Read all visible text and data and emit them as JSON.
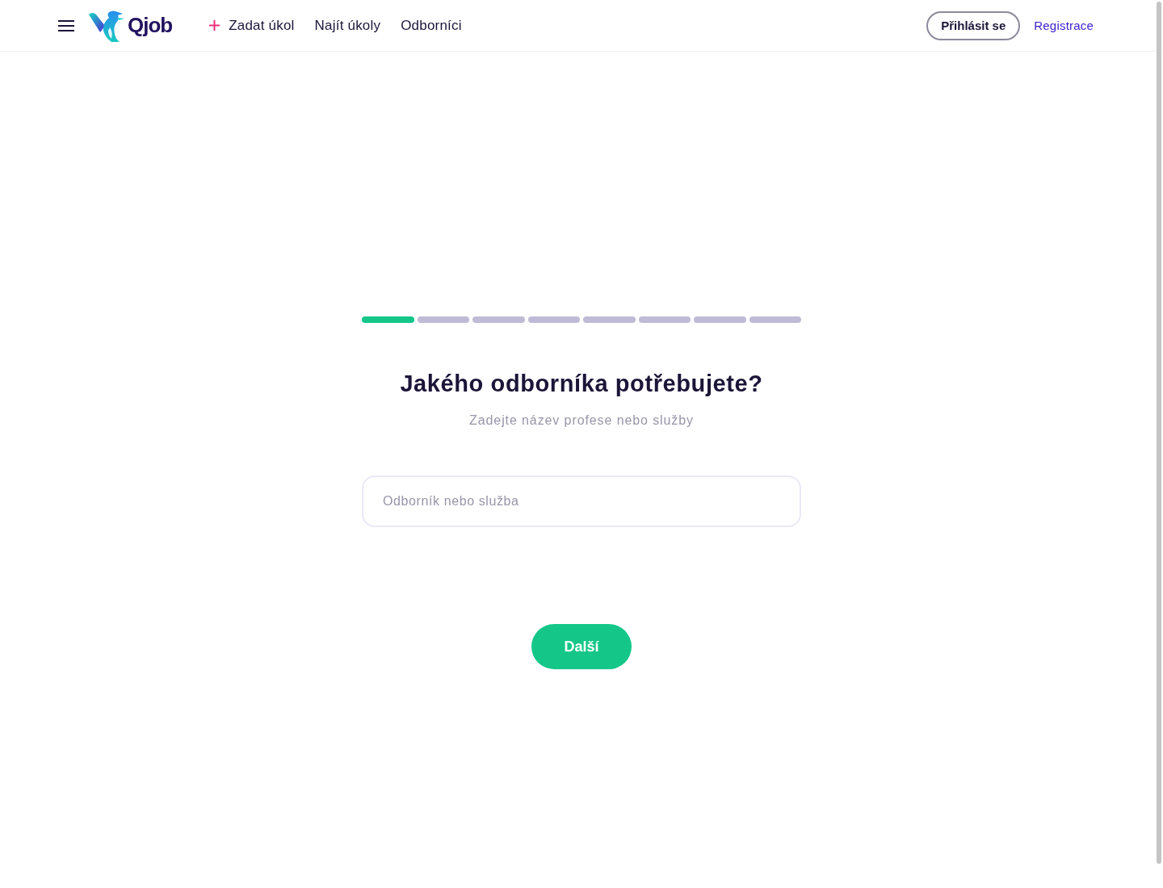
{
  "header": {
    "logo": {
      "text": "Qjob"
    },
    "nav": [
      {
        "label": "Zadat úkol",
        "kind": "add"
      },
      {
        "label": "Najít úkoly",
        "kind": "link"
      },
      {
        "label": "Odborníci",
        "kind": "link"
      }
    ],
    "login_button": "Přihlásit se",
    "register_link": "Registrace"
  },
  "wizard": {
    "steps": [
      {
        "done": true
      },
      {
        "done": false
      },
      {
        "done": false
      },
      {
        "done": false
      },
      {
        "done": false
      },
      {
        "done": false
      },
      {
        "done": false
      },
      {
        "done": false
      }
    ],
    "title": "Jakého odborníka potřebujete?",
    "subtitle": "Zadejte název profese nebo služby",
    "search": {
      "placeholder": "Odborník nebo služba"
    },
    "next_button": "Další"
  }
}
